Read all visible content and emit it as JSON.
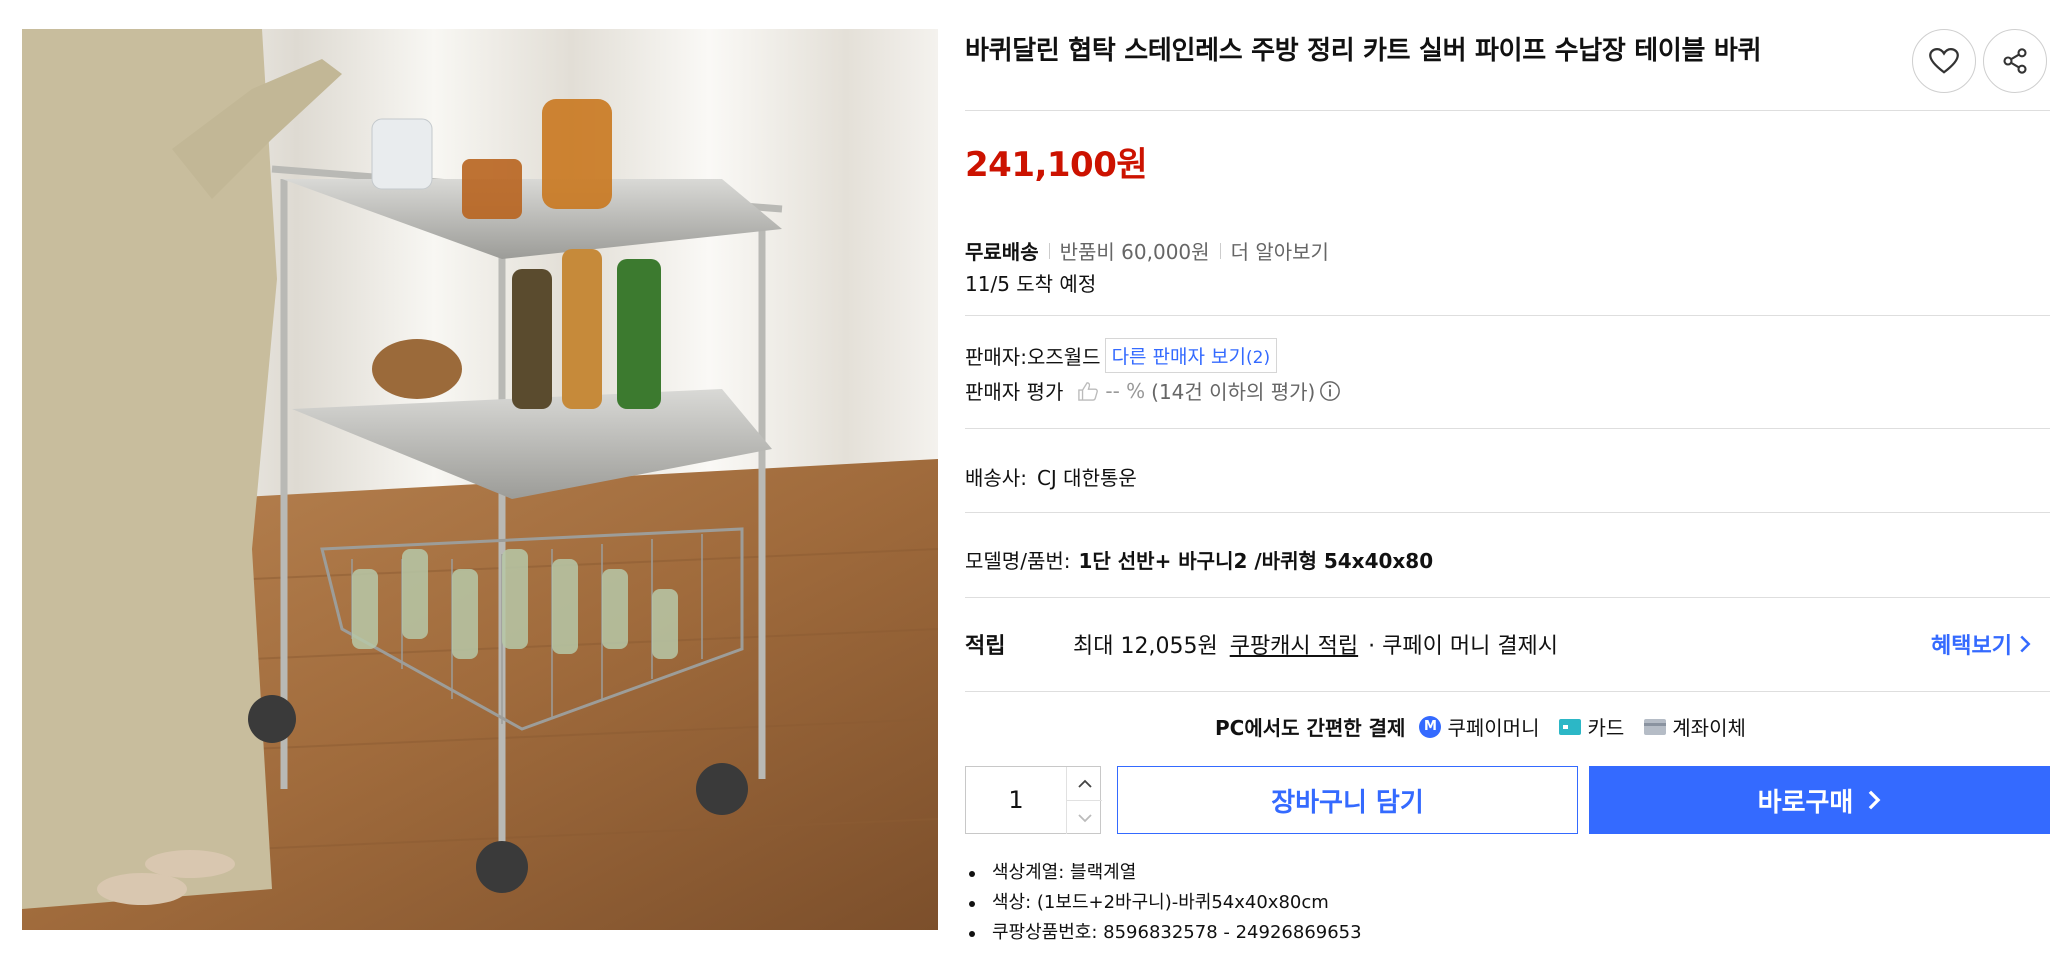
{
  "product": {
    "title": "바퀴달린 협탁 스테인레스 주방 정리 카트 실버 파이프 수납장 테이블 바퀴",
    "image_alt": "stainless steel kitchen cart with wheels",
    "price": "241,100원"
  },
  "shipping": {
    "free_label": "무료배송",
    "return_fee": "반품비 60,000원",
    "learn_more": "더 알아보기",
    "arrival": "11/5 도착 예정"
  },
  "seller": {
    "label": "판매자:",
    "name": "오즈월드",
    "other_sellers_text": "다른 판매자 보기",
    "other_sellers_count": "(2)",
    "rating_label": "판매자 평가",
    "rating_value": "-- %",
    "rating_note": "(14건 이하의 평가)"
  },
  "carrier": {
    "label": "배송사:",
    "name": "CJ 대한통운"
  },
  "model": {
    "label": "모델명/품번:",
    "value": "1단 선반+ 바구니2 /바퀴형 54x40x80"
  },
  "rewards": {
    "label": "적립",
    "max_text": "최대 12,055원",
    "cash_link": "쿠팡캐시 적립",
    "suffix": "· 쿠페이 머니 결제시",
    "benefits_link": "혜택보기"
  },
  "payment": {
    "label": "PC에서도 간편한 결제",
    "coupay_icon": "M",
    "methods": [
      "쿠페이머니",
      "카드",
      "계좌이체"
    ]
  },
  "purchase": {
    "quantity": "1",
    "cart_button": "장바구니 담기",
    "buy_button": "바로구매"
  },
  "details": [
    "색상계열: 블랙계열",
    "색상: (1보드+2바구니)-바퀴54x40x80cm",
    "쿠팡상품번호: 8596832578 - 24926869653"
  ],
  "colors": {
    "price_red": "#cc1200",
    "brand_blue": "#346aff",
    "divider": "#dedede"
  },
  "icons": [
    "heart-icon",
    "share-icon",
    "thumbs-up-icon",
    "info-icon",
    "chevron-up-icon",
    "chevron-down-icon",
    "chevron-right-icon",
    "card-icon",
    "bank-icon"
  ]
}
